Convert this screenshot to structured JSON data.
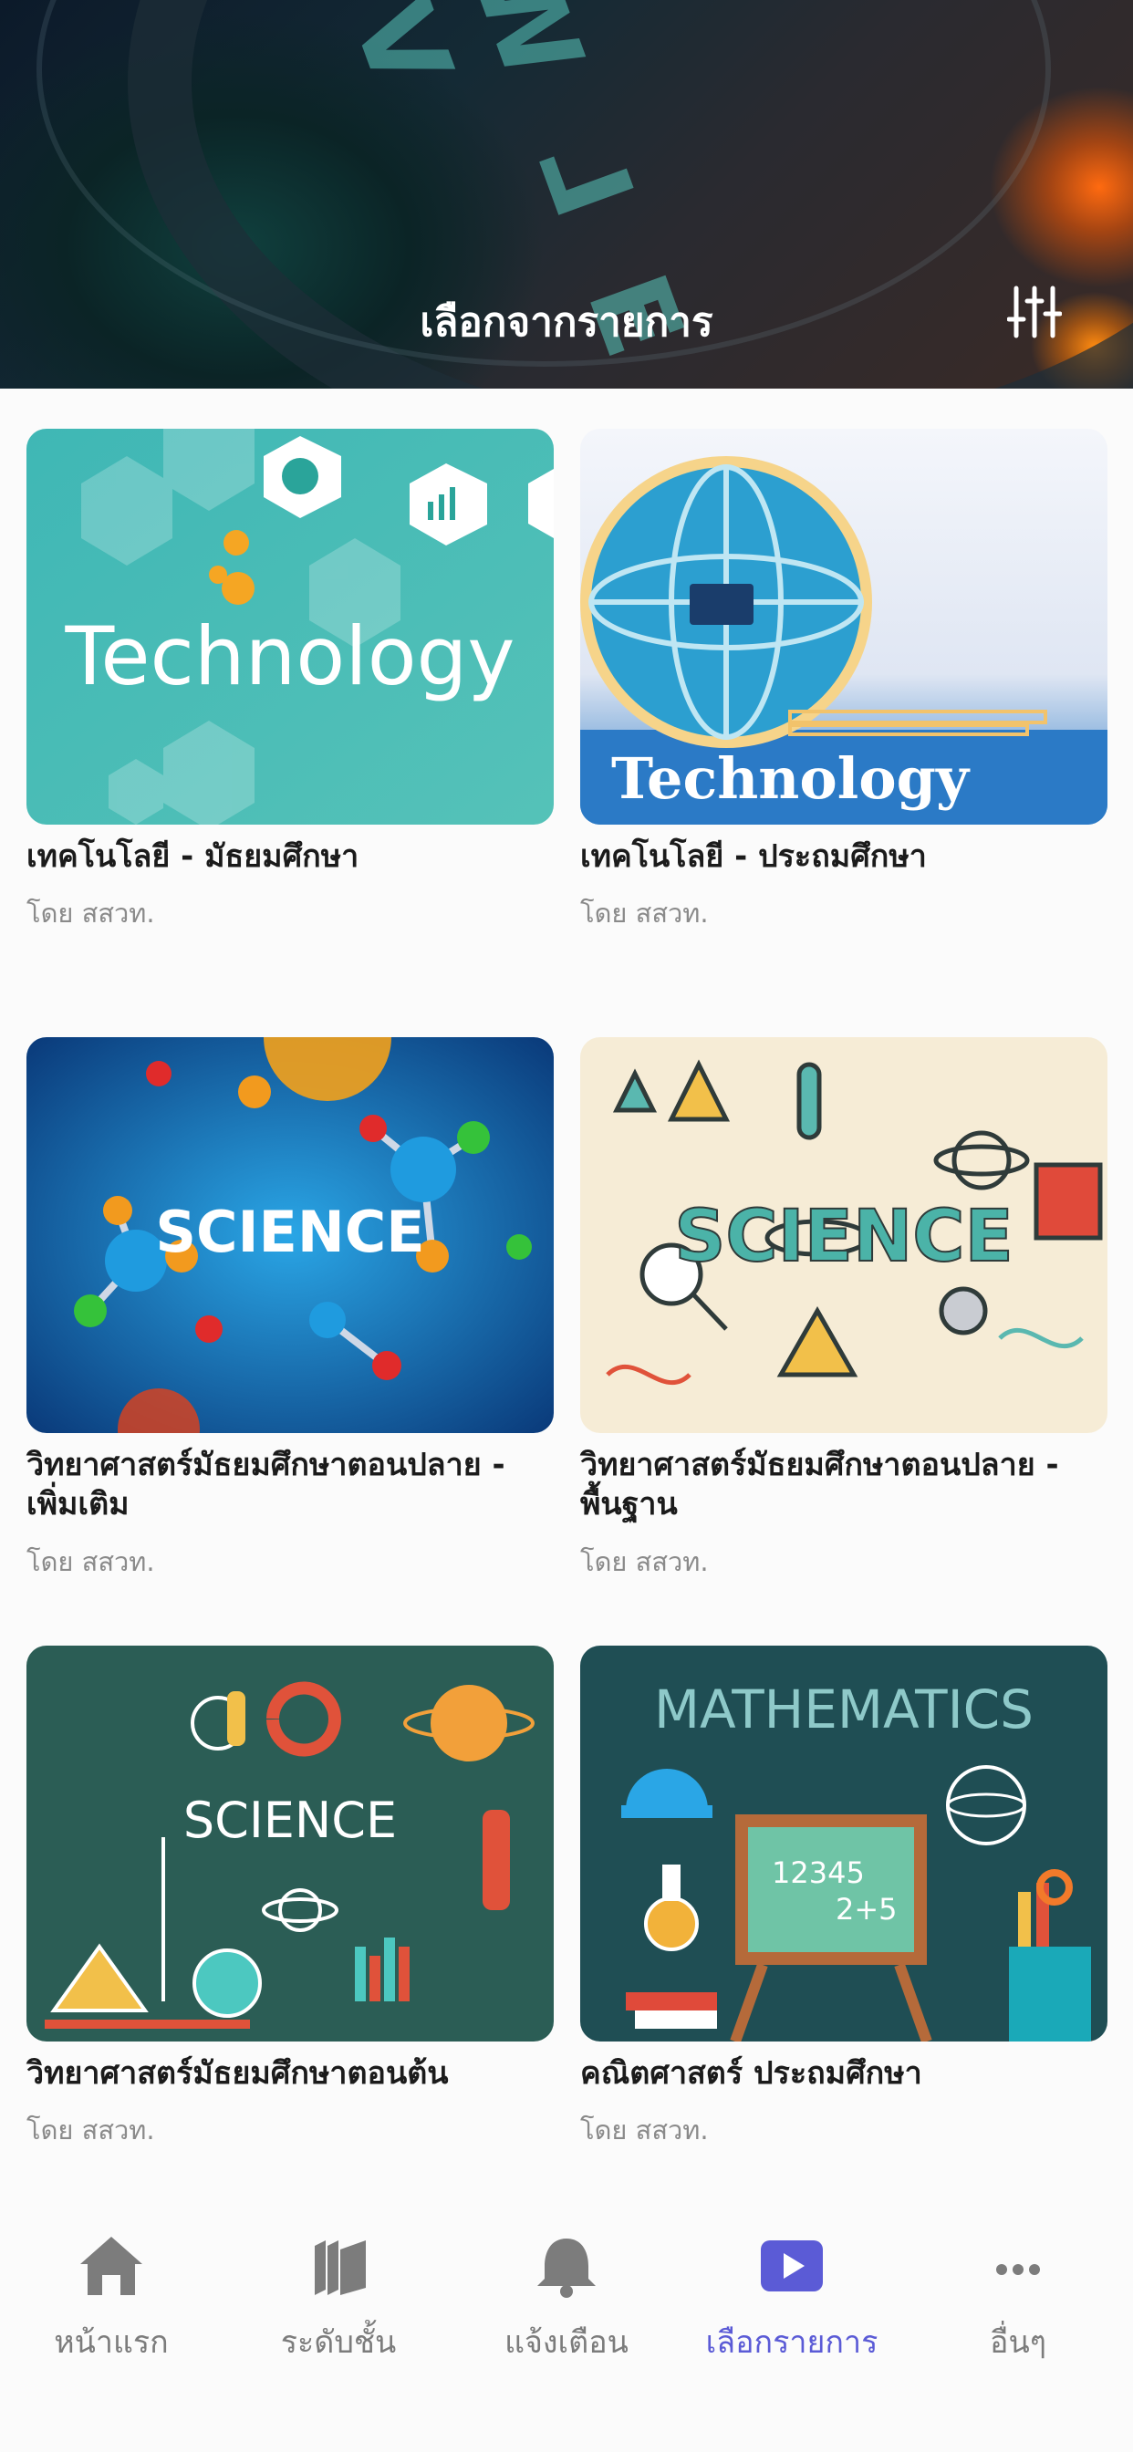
{
  "header": {
    "title": "เลือกจากรายการ",
    "filter_icon": "sliders-icon"
  },
  "cards": [
    {
      "title": "เทคโนโลยี - มัธยมศึกษา",
      "author": "โดย สสวท.",
      "thumbnail_text": "Technology"
    },
    {
      "title": "เทคโนโลยี - ประถมศึกษา",
      "author": "โดย สสวท.",
      "thumbnail_text": "Technology"
    },
    {
      "title": "วิทยาศาสตร์มัธยมศึกษาตอนปลาย - เพิ่มเติม",
      "author": "โดย สสวท.",
      "thumbnail_text": "SCIENCE"
    },
    {
      "title": "วิทยาศาสตร์มัธยมศึกษาตอนปลาย - พื้นฐาน",
      "author": "โดย สสวท.",
      "thumbnail_text": "SCIENCE"
    },
    {
      "title": "วิทยาศาสตร์มัธยมศึกษาตอนต้น",
      "author": "โดย สสวท.",
      "thumbnail_text": "SCIENCE"
    },
    {
      "title": "คณิตศาสตร์ ประถมศึกษา",
      "author": "โดย สสวท.",
      "thumbnail_text": "MATHEMATICS",
      "board_top": "12345",
      "board_bottom": "2+5"
    }
  ],
  "bottom_nav": {
    "items": [
      {
        "label": "หน้าแรก",
        "icon": "home-icon"
      },
      {
        "label": "ระดับชั้น",
        "icon": "books-icon"
      },
      {
        "label": "แจ้งเตือน",
        "icon": "bell-icon"
      },
      {
        "label": "เลือกรายการ",
        "icon": "play-icon",
        "active": true
      },
      {
        "label": "อื่นๆ",
        "icon": "more-icon"
      }
    ]
  },
  "colors": {
    "accent": "#5b5bd6",
    "nav_inactive": "#7c7c7c",
    "title": "#1b1b1b",
    "author": "#8a8a8a"
  }
}
